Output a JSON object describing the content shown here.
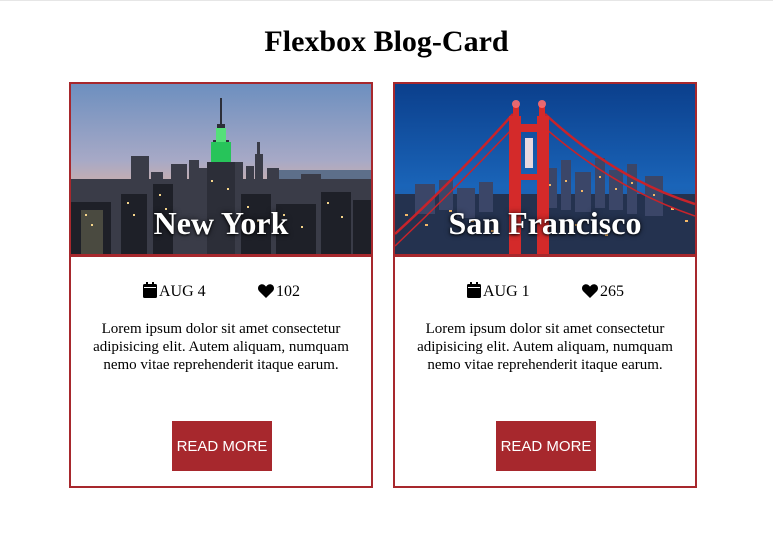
{
  "page": {
    "title": "Flexbox Blog-Card"
  },
  "colors": {
    "accent": "#a7282d",
    "text": "#000000",
    "background": "#ffffff"
  },
  "cards": [
    {
      "city": "New York",
      "image_icon": "new-york-skyline-image",
      "date": "AUG 4",
      "likes": "102",
      "description": "Lorem ipsum dolor sit amet consectetur adipisicing elit. Autem aliquam, numquam nemo vitae reprehenderit itaque earum.",
      "button_label": "READ MORE"
    },
    {
      "city": "San Francisco",
      "image_icon": "golden-gate-bridge-image",
      "date": "AUG 1",
      "likes": "265",
      "description": "Lorem ipsum dolor sit amet consectetur adipisicing elit. Autem aliquam, numquam nemo vitae reprehenderit itaque earum.",
      "button_label": "READ MORE"
    }
  ]
}
